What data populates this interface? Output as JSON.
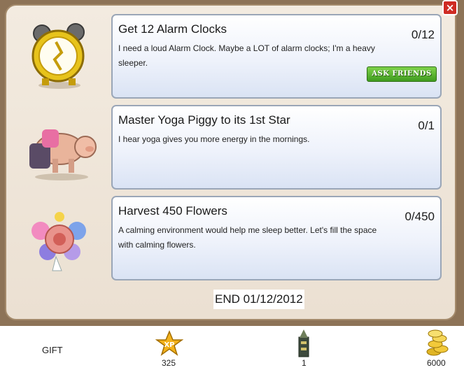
{
  "quests": [
    {
      "title": "Get 12 Alarm Clocks",
      "description": "I need a loud Alarm Clock. Maybe a LOT of alarm clocks; I'm a heavy sleeper.",
      "progress": "0/12",
      "button": "ASK FRIENDS",
      "icon": "alarm-clock-icon"
    },
    {
      "title": "Master Yoga Piggy to its 1st Star",
      "description": "I hear yoga gives you more energy in the mornings.",
      "progress": "0/1",
      "icon": "yoga-piggy-icon"
    },
    {
      "title": "Harvest 450 Flowers",
      "description": "A calming environment would help me sleep better. Let's fill the space with calming flowers.",
      "progress": "0/450",
      "icon": "flower-bouquet-icon"
    }
  ],
  "end_date": "END 01/12/2012",
  "close_label": "×",
  "rewards": {
    "gift_label": "GIFT",
    "xp_badge": "XP",
    "xp_value": "325",
    "item_value": "1",
    "coins_value": "6000"
  },
  "colors": {
    "panel": "#ebe0d2",
    "frame": "#8d7357",
    "card": "#e6ecf8",
    "ask_button": "#4fae2a",
    "close": "#cf2b23"
  }
}
